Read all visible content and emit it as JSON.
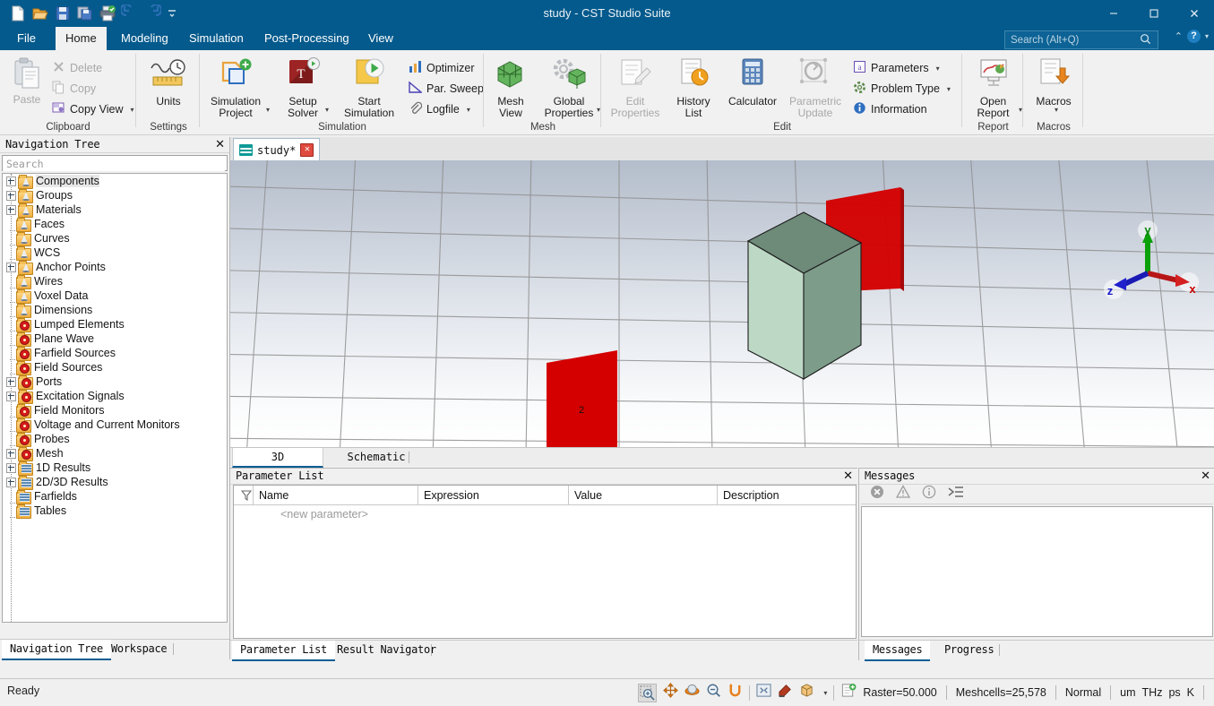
{
  "window": {
    "title": "study - CST Studio Suite",
    "minimize": "–",
    "maximize": "☐",
    "close": "✕"
  },
  "quick_access": [
    {
      "name": "new-file-icon",
      "label": "New"
    },
    {
      "name": "open-file-icon",
      "label": "Open"
    },
    {
      "name": "save-icon",
      "label": "Save"
    },
    {
      "name": "save-as-icon",
      "label": "Save As"
    },
    {
      "name": "print-icon",
      "label": "Print"
    },
    {
      "name": "undo-icon",
      "label": "Undo"
    },
    {
      "name": "redo-icon",
      "label": "Redo"
    },
    {
      "name": "customize-qat-icon",
      "label": "Customize"
    }
  ],
  "ribbon_tabs": [
    {
      "label": "File",
      "active": false
    },
    {
      "label": "Home",
      "active": true
    },
    {
      "label": "Modeling",
      "active": false
    },
    {
      "label": "Simulation",
      "active": false
    },
    {
      "label": "Post-Processing",
      "active": false
    },
    {
      "label": "View",
      "active": false
    }
  ],
  "search": {
    "placeholder": "Search (Alt+Q)",
    "value": "",
    "icon": "search-icon"
  },
  "help": {
    "collapse_caret": "⌃",
    "help_label": "?",
    "dropdown_caret": "▾"
  },
  "ribbon_groups": [
    {
      "name": "clipboard",
      "label": "Clipboard",
      "big_buttons": [
        {
          "label": "Paste",
          "icon": "paste-icon",
          "disabled": true
        }
      ],
      "small_buttons": [
        {
          "label": "Delete",
          "icon": "delete-icon",
          "disabled": true,
          "caret": ""
        },
        {
          "label": "Copy",
          "icon": "copy-icon",
          "disabled": true,
          "caret": ""
        },
        {
          "label": "Copy View",
          "icon": "copy-view-icon",
          "disabled": false,
          "caret": "▾"
        }
      ]
    },
    {
      "name": "settings",
      "label": "Settings",
      "big_buttons": [
        {
          "label": "Units",
          "icon": "units-icon",
          "disabled": false
        }
      ],
      "small_buttons": []
    },
    {
      "name": "simulation",
      "label": "Simulation",
      "big_buttons": [
        {
          "label": "Simulation Project",
          "icon": "simulation-project-icon",
          "disabled": false,
          "caret": "▾"
        },
        {
          "label": "Setup Solver",
          "icon": "setup-solver-icon",
          "disabled": false,
          "caret": "▾"
        },
        {
          "label": "Start Simulation",
          "icon": "start-simulation-icon",
          "disabled": false
        }
      ],
      "small_buttons": [
        {
          "label": "Optimizer",
          "icon": "optimizer-icon",
          "disabled": false,
          "caret": ""
        },
        {
          "label": "Par. Sweep",
          "icon": "par-sweep-icon",
          "disabled": false,
          "caret": ""
        },
        {
          "label": "Logfile",
          "icon": "logfile-icon",
          "disabled": false,
          "caret": "▾"
        }
      ]
    },
    {
      "name": "mesh",
      "label": "Mesh",
      "big_buttons": [
        {
          "label": "Mesh View",
          "icon": "mesh-view-icon",
          "disabled": false
        },
        {
          "label": "Global Properties",
          "icon": "global-properties-icon",
          "disabled": false,
          "caret": "▾"
        }
      ],
      "small_buttons": []
    },
    {
      "name": "edit",
      "label": "Edit",
      "big_buttons": [
        {
          "label": "Edit Properties",
          "icon": "edit-properties-icon",
          "disabled": true
        },
        {
          "label": "History List",
          "icon": "history-list-icon",
          "disabled": false
        },
        {
          "label": "Calculator",
          "icon": "calculator-icon",
          "disabled": false
        },
        {
          "label": "Parametric Update",
          "icon": "parametric-update-icon",
          "disabled": true
        }
      ],
      "small_buttons": [
        {
          "label": "Parameters",
          "icon": "parameters-icon",
          "disabled": false,
          "caret": "▾"
        },
        {
          "label": "Problem Type",
          "icon": "problem-type-icon",
          "disabled": false,
          "caret": "▾"
        },
        {
          "label": "Information",
          "icon": "information-icon",
          "disabled": false,
          "caret": ""
        }
      ]
    },
    {
      "name": "report",
      "label": "Report",
      "big_buttons": [
        {
          "label": "Open Report",
          "icon": "open-report-icon",
          "disabled": false,
          "caret": "▾"
        }
      ],
      "small_buttons": []
    },
    {
      "name": "macros",
      "label": "Macros",
      "big_buttons": [
        {
          "label": "Macros",
          "icon": "macros-icon",
          "disabled": false,
          "caret": "▾"
        }
      ],
      "small_buttons": []
    }
  ],
  "navigation_panel": {
    "title": "Navigation Tree",
    "close": "✕",
    "search_placeholder": "Search",
    "search_value": "",
    "items": [
      {
        "label": "Components",
        "expandable": true,
        "icon": "folder-cone-icon",
        "selected": true
      },
      {
        "label": "Groups",
        "expandable": true,
        "icon": "folder-cone-icon",
        "selected": false
      },
      {
        "label": "Materials",
        "expandable": true,
        "icon": "folder-cone-icon",
        "selected": false
      },
      {
        "label": "Faces",
        "expandable": false,
        "icon": "folder-cone-icon",
        "selected": false
      },
      {
        "label": "Curves",
        "expandable": false,
        "icon": "folder-cone-icon",
        "selected": false
      },
      {
        "label": "WCS",
        "expandable": false,
        "icon": "folder-cone-icon",
        "selected": false
      },
      {
        "label": "Anchor Points",
        "expandable": true,
        "icon": "folder-cone-icon",
        "selected": false
      },
      {
        "label": "Wires",
        "expandable": false,
        "icon": "folder-cone-icon",
        "selected": false
      },
      {
        "label": "Voxel Data",
        "expandable": false,
        "icon": "folder-cone-icon",
        "selected": false
      },
      {
        "label": "Dimensions",
        "expandable": false,
        "icon": "folder-cone-icon",
        "selected": false
      },
      {
        "label": "Lumped Elements",
        "expandable": false,
        "icon": "folder-source-icon",
        "selected": false
      },
      {
        "label": "Plane Wave",
        "expandable": false,
        "icon": "folder-source-icon",
        "selected": false
      },
      {
        "label": "Farfield Sources",
        "expandable": false,
        "icon": "folder-source-icon",
        "selected": false
      },
      {
        "label": "Field Sources",
        "expandable": false,
        "icon": "folder-source-icon",
        "selected": false
      },
      {
        "label": "Ports",
        "expandable": true,
        "icon": "folder-source-icon",
        "selected": false
      },
      {
        "label": "Excitation Signals",
        "expandable": true,
        "icon": "folder-source-icon",
        "selected": false
      },
      {
        "label": "Field Monitors",
        "expandable": false,
        "icon": "folder-source-icon",
        "selected": false
      },
      {
        "label": "Voltage and Current Monitors",
        "expandable": false,
        "icon": "folder-source-icon",
        "selected": false
      },
      {
        "label": "Probes",
        "expandable": false,
        "icon": "folder-source-icon",
        "selected": false
      },
      {
        "label": "Mesh",
        "expandable": true,
        "icon": "folder-source-icon",
        "selected": false
      },
      {
        "label": "1D Results",
        "expandable": true,
        "icon": "folder-results-icon",
        "selected": false
      },
      {
        "label": "2D/3D Results",
        "expandable": true,
        "icon": "folder-results-icon",
        "selected": false
      },
      {
        "label": "Farfields",
        "expandable": false,
        "icon": "folder-results-icon",
        "selected": false
      },
      {
        "label": "Tables",
        "expandable": false,
        "icon": "folder-results-icon",
        "selected": false
      }
    ],
    "dock_tabs": [
      {
        "label": "Navigation Tree",
        "active": true
      },
      {
        "label": "Workspace",
        "active": false
      }
    ]
  },
  "viewport": {
    "document_tab": {
      "label": "study*",
      "icon": "cst-wave-icon",
      "close": "✕"
    },
    "bottom_tabs": [
      {
        "label": "3D",
        "active": true
      },
      {
        "label": "Schematic",
        "active": false
      }
    ],
    "port_label": "2",
    "axis_triad": {
      "x": "x",
      "y": "y",
      "z": "z",
      "x_color": "#cc0000",
      "y_color": "#00a000",
      "z_color": "#0000cc"
    },
    "colors": {
      "background_top": "#b6bfcd",
      "background_bottom": "#ffffff",
      "grid_line": "#8d8d8d",
      "solid_front": "#bcd9c6",
      "solid_side": "#7e9c8a",
      "solid_top": "#6c8878",
      "port_red": "#d40000"
    }
  },
  "parameter_panel": {
    "title": "Parameter List",
    "close": "✕",
    "filter_icon": "filter-icon",
    "columns": [
      "Name",
      "Expression",
      "Value",
      "Description"
    ],
    "rows": [],
    "new_row_placeholder": "<new parameter>",
    "dock_tabs": [
      {
        "label": "Parameter List",
        "active": true
      },
      {
        "label": "Result Navigator",
        "active": false
      }
    ]
  },
  "messages_panel": {
    "title": "Messages",
    "close": "✕",
    "toolbar": [
      {
        "name": "error-filter-icon",
        "label": "Errors"
      },
      {
        "name": "warning-filter-icon",
        "label": "Warnings"
      },
      {
        "name": "info-filter-icon",
        "label": "Information"
      },
      {
        "name": "clear-messages-icon",
        "label": "Clear"
      }
    ],
    "messages": [],
    "dock_tabs": [
      {
        "label": "Messages",
        "active": true
      },
      {
        "label": "Progress",
        "active": false
      }
    ]
  },
  "status_bar": {
    "ready_text": "Ready",
    "tools": [
      {
        "name": "zoom-in-icon",
        "active": true
      },
      {
        "name": "pan-icon",
        "active": false
      },
      {
        "name": "rotate-icon",
        "active": false
      },
      {
        "name": "zoom-out-icon",
        "active": false
      },
      {
        "name": "reset-view-icon",
        "active": false
      },
      {
        "name": "fit-to-screen-icon",
        "active": false
      },
      {
        "name": "paint-view-icon",
        "active": false
      },
      {
        "name": "view-cube-icon",
        "active": false
      },
      {
        "name": "add-field-icon",
        "active": false
      }
    ],
    "raster": "Raster=50.000",
    "meshcells": "Meshcells=25,578",
    "mode": "Normal",
    "units": [
      "um",
      "THz",
      "ps",
      "K"
    ]
  }
}
